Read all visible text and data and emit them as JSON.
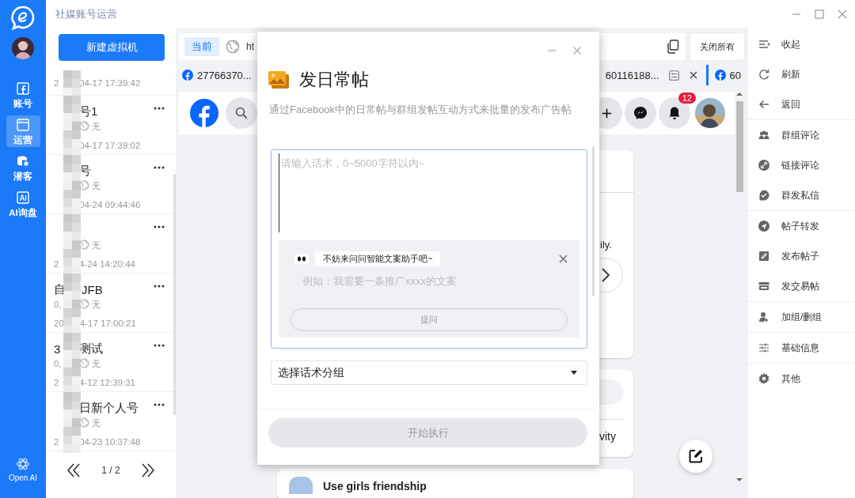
{
  "app": {
    "title": "社媒账号运营"
  },
  "nav": {
    "items": [
      {
        "label": "账号",
        "selected": false
      },
      {
        "label": "运营",
        "selected": true
      },
      {
        "label": "潜客",
        "selected": false
      },
      {
        "label": "AI询盘",
        "selected": false
      }
    ],
    "bottom_label": "Open AI"
  },
  "accounts": {
    "new_button": "新建虚拟机",
    "partial_time": {
      "start": "2",
      "end": "04-17 17:39:42"
    },
    "items": [
      {
        "name_end": "号1",
        "meta": "无",
        "time_end": "04-17 17:39:02"
      },
      {
        "name_end": "号",
        "meta": "无",
        "time_end": "04-24 09:44:46"
      },
      {
        "meta": "无",
        "time_start": "2",
        "time_end": "4-24 14:20:44"
      },
      {
        "name_start": "自",
        "name_end": "JFB",
        "meta_start": "0,",
        "meta": "无",
        "time_start": "20",
        "time_end": "4-17 17:00:21"
      },
      {
        "name_start": "3",
        "name_end": "测试",
        "meta_start": "0,",
        "meta": "无",
        "time_start": "2",
        "time_end": "4-12 12:39:31"
      },
      {
        "name_end": "日新个人号",
        "meta": "无",
        "time_start": "2",
        "time_end": "04-23 10:37:48"
      }
    ],
    "pager": "1 / 2"
  },
  "browser": {
    "current": "当前",
    "url": "ht",
    "close_all": "关闭所有",
    "tabs": [
      {
        "label": "27766370...",
        "selected": false
      },
      {
        "label": "60116188...",
        "selected": false
      },
      {
        "label": "60",
        "selected": true
      }
    ],
    "notification_count": "12",
    "feed": {
      "snippet_1": "ily.",
      "snippet_2": "vity",
      "post_title": "Use girls friendship"
    }
  },
  "dialog": {
    "title": "发日常帖",
    "subtitle": "通过Facebook中的日常帖与群组发帖互动方式来批量的发布广告帖",
    "content_placeholder": "请输入话术，0~5000字符以内~",
    "assistant": {
      "prompt": "不妨来问问智能文案助手吧~",
      "placeholder": "例如：我需要一条推广xxxx的文案",
      "ask_button": "提问",
      "ask_disabled": true
    },
    "group_select": "选择话术分组",
    "start_button": "开始执行",
    "start_disabled": true
  },
  "right_menu": {
    "groups": [
      [
        {
          "label": "收起"
        },
        {
          "label": "刷新"
        },
        {
          "label": "返回"
        }
      ],
      [
        {
          "label": "群组评论"
        },
        {
          "label": "链接评论"
        },
        {
          "label": "群发私信"
        }
      ],
      [
        {
          "label": "帖子转发"
        },
        {
          "label": "发布帖子"
        },
        {
          "label": "发交易帖"
        }
      ],
      [
        {
          "label": "加组/删组"
        }
      ],
      [
        {
          "label": "基础信息"
        }
      ],
      [
        {
          "label": "其他"
        }
      ]
    ]
  }
}
